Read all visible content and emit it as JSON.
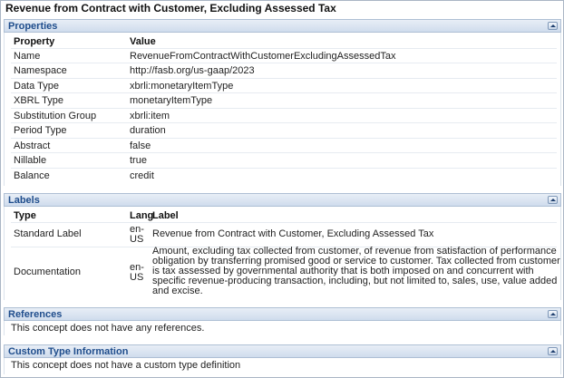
{
  "title": "Revenue from Contract with Customer, Excluding Assessed Tax",
  "properties": {
    "section_title": "Properties",
    "col_property": "Property",
    "col_value": "Value",
    "rows": [
      {
        "property": "Name",
        "value": "RevenueFromContractWithCustomerExcludingAssessedTax"
      },
      {
        "property": "Namespace",
        "value": "http://fasb.org/us-gaap/2023"
      },
      {
        "property": "Data Type",
        "value": "xbrli:monetaryItemType"
      },
      {
        "property": "XBRL Type",
        "value": "monetaryItemType"
      },
      {
        "property": "Substitution Group",
        "value": "xbrli:item"
      },
      {
        "property": "Period Type",
        "value": "duration"
      },
      {
        "property": "Abstract",
        "value": "false"
      },
      {
        "property": "Nillable",
        "value": "true"
      },
      {
        "property": "Balance",
        "value": "credit"
      }
    ]
  },
  "labels": {
    "section_title": "Labels",
    "col_type": "Type",
    "col_lang": "Lang",
    "col_label": "Label",
    "rows": [
      {
        "type": "Standard Label",
        "lang_1": "en-",
        "lang_2": "US",
        "label": "Revenue from Contract with Customer, Excluding Assessed Tax"
      },
      {
        "type": "Documentation",
        "lang_1": "en-",
        "lang_2": "US",
        "label_lines": [
          "Amount, excluding tax collected from customer, of revenue from satisfaction of performance",
          "obligation by transferring promised good or service to customer. Tax collected from customer",
          "is tax assessed by governmental authority that is both imposed on and concurrent with",
          "specific revenue-producing transaction, including, but not limited to, sales, use, value added",
          "and excise."
        ]
      }
    ]
  },
  "references": {
    "section_title": "References",
    "text": "This concept does not have any references."
  },
  "custom_type": {
    "section_title": "Custom Type Information",
    "text": "This concept does not have a custom type definition"
  },
  "icons": {
    "collapse": "collapse-up-arrow-icon"
  }
}
